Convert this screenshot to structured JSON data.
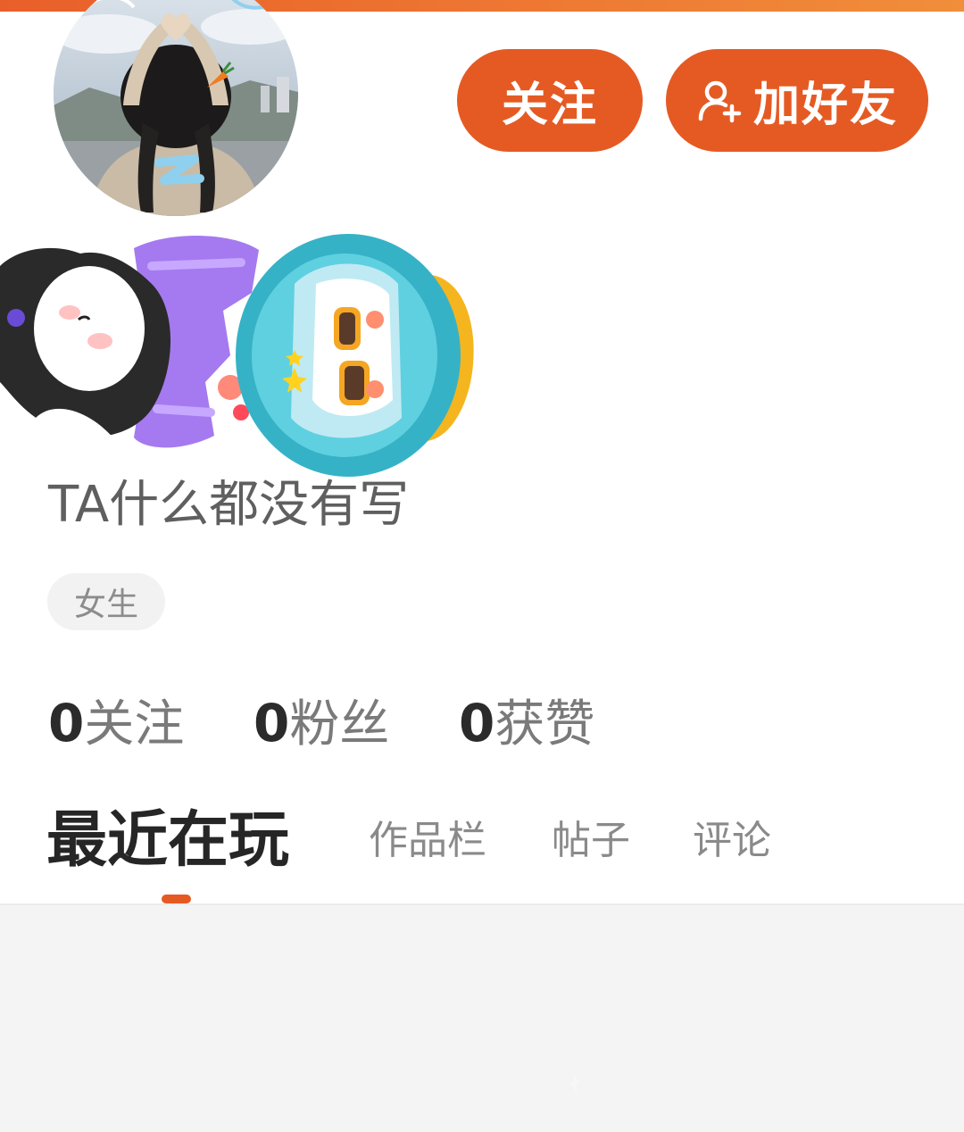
{
  "profile": {
    "bio": "TA什么都没有写",
    "gender_tag": "女生"
  },
  "actions": {
    "follow_label": "关注",
    "add_friend_label": "加好友"
  },
  "stats": {
    "following_count": "0",
    "following_label": "关注",
    "fans_count": "0",
    "fans_label": "粉丝",
    "likes_count": "0",
    "likes_label": "获赞"
  },
  "tabs": [
    {
      "label": "最近在玩",
      "active": true
    },
    {
      "label": "作品栏",
      "active": false
    },
    {
      "label": "帖子",
      "active": false
    },
    {
      "label": "评论",
      "active": false
    }
  ],
  "colors": {
    "accent": "#e55a23",
    "header_gradient_end": "#f08e3a",
    "tag_background": "#f2f2f2",
    "content_background": "#f4f4f4"
  },
  "icons": {
    "add_friend": "add-user-icon",
    "avatar": "avatar-photo",
    "badge": "sticker-badge"
  }
}
